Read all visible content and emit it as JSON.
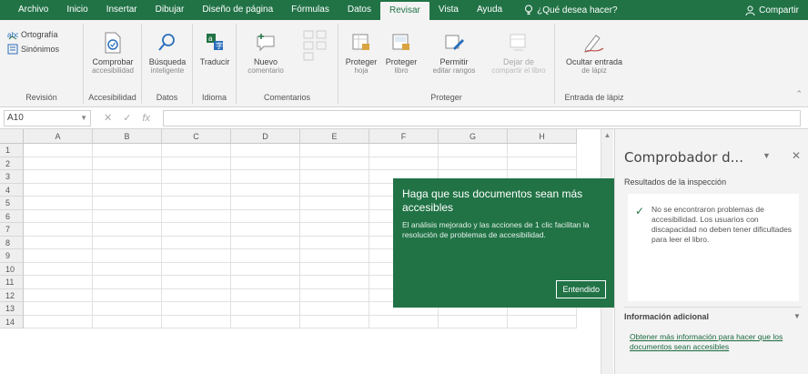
{
  "colors": {
    "brand": "#217346",
    "ribbon_bg": "#f3f3f3",
    "pane_bg": "#f3f3f3"
  },
  "menubar": {
    "tabs": [
      "Archivo",
      "Inicio",
      "Insertar",
      "Dibujar",
      "Diseño de página",
      "Fórmulas",
      "Datos",
      "Revisar",
      "Vista",
      "Ayuda"
    ],
    "active_tab": "Revisar",
    "tell_me": "¿Qué desea hacer?",
    "share": "Compartir"
  },
  "ribbon": {
    "revision": {
      "label": "Revisión",
      "spelling": "Ortografía",
      "synonyms": "Sinónimos"
    },
    "accessibility": {
      "label": "Accesibilidad",
      "check_line1": "Comprobar",
      "check_line2": "accesibilidad"
    },
    "data": {
      "label": "Datos",
      "smart_line1": "Búsqueda",
      "smart_line2": "inteligente"
    },
    "language": {
      "label": "Idioma",
      "translate": "Traducir"
    },
    "comments": {
      "label": "Comentarios",
      "new_line1": "Nuevo",
      "new_line2": "comentario"
    },
    "protect": {
      "label": "Proteger",
      "sheet_line1": "Proteger",
      "sheet_line2": "hoja",
      "book_line1": "Proteger",
      "book_line2": "libro",
      "allow_line1": "Permitir",
      "allow_line2": "editar rangos",
      "unshare_line1": "Dejar de",
      "unshare_line2": "compartir el libro"
    },
    "ink": {
      "label": "Entrada de lápiz",
      "hide_line1": "Ocultar entrada",
      "hide_line2": "de lápiz"
    }
  },
  "formula_bar": {
    "name_box": "A10",
    "cancel": "✕",
    "enter": "✓",
    "fx": "fx"
  },
  "grid": {
    "columns": [
      "A",
      "B",
      "C",
      "D",
      "E",
      "F",
      "G",
      "H"
    ],
    "rows": [
      "1",
      "2",
      "3",
      "4",
      "5",
      "6",
      "7",
      "8",
      "9",
      "10",
      "11",
      "12",
      "13",
      "14"
    ]
  },
  "tooltip": {
    "title": "Haga que sus documentos sean más accesibles",
    "body": "El análisis mejorado y las acciones de 1 clic facilitan la resolución de problemas de accesibilidad.",
    "button": "Entendido"
  },
  "pane": {
    "title": "Comprobador d...",
    "results_label": "Resultados de la inspección",
    "result_message": "No se encontraron problemas de accesibilidad. Los usuarios con discapacidad no deben tener dificultades para leer el libro.",
    "additional_label": "Información adicional",
    "link": "Obtener más información para hacer que los documentos sean accesibles"
  }
}
